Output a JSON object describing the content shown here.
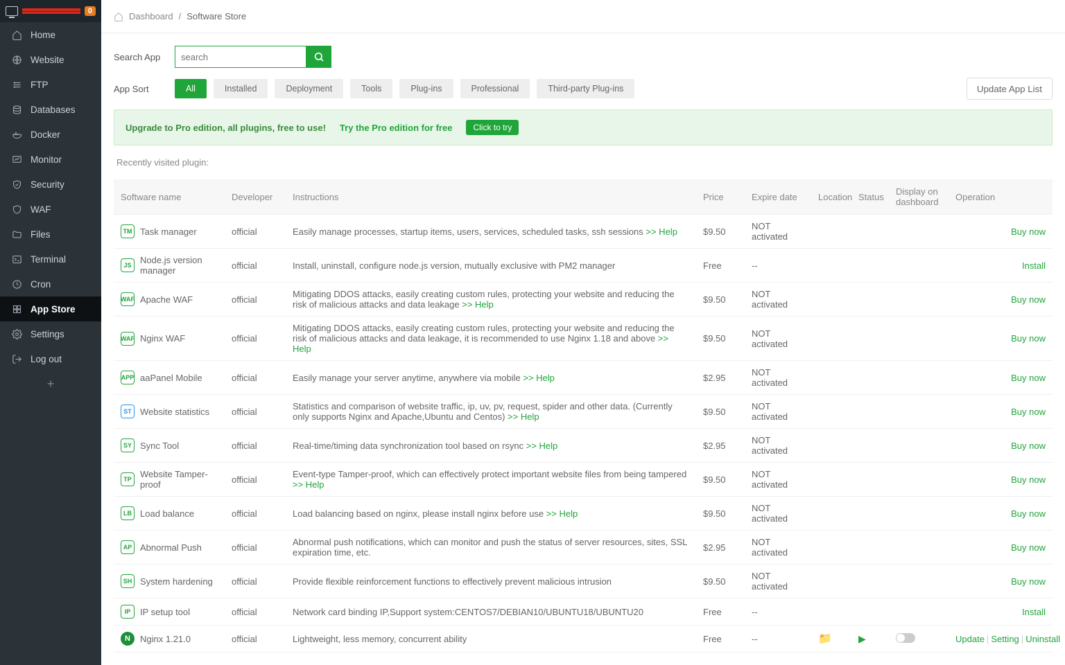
{
  "sidebar": {
    "badge": "0",
    "items": [
      {
        "icon": "home",
        "label": "Home"
      },
      {
        "icon": "globe",
        "label": "Website"
      },
      {
        "icon": "ftp",
        "label": "FTP"
      },
      {
        "icon": "database",
        "label": "Databases"
      },
      {
        "icon": "docker",
        "label": "Docker"
      },
      {
        "icon": "monitor",
        "label": "Monitor"
      },
      {
        "icon": "shield",
        "label": "Security"
      },
      {
        "icon": "waf",
        "label": "WAF"
      },
      {
        "icon": "folder",
        "label": "Files"
      },
      {
        "icon": "terminal",
        "label": "Terminal"
      },
      {
        "icon": "cron",
        "label": "Cron"
      },
      {
        "icon": "grid",
        "label": "App Store",
        "active": true
      },
      {
        "icon": "gear",
        "label": "Settings"
      },
      {
        "icon": "logout",
        "label": "Log out"
      }
    ]
  },
  "breadcrumb": {
    "dashboard": "Dashboard",
    "current": "Software Store"
  },
  "search": {
    "label": "Search App",
    "placeholder": "search"
  },
  "sort": {
    "label": "App Sort",
    "buttons": [
      "All",
      "Installed",
      "Deployment",
      "Tools",
      "Plug-ins",
      "Professional",
      "Third-party Plug-ins"
    ],
    "active": 0,
    "update": "Update App List"
  },
  "upgrade": {
    "bold": "Upgrade to Pro edition, all plugins, free to use!",
    "try": "Try the Pro edition for free",
    "click": "Click to try"
  },
  "recent": "Recently visited plugin:",
  "table": {
    "headers": {
      "name": "Software name",
      "dev": "Developer",
      "instr": "Instructions",
      "price": "Price",
      "expire": "Expire date",
      "location": "Location",
      "status": "Status",
      "display": "Display on dashboard",
      "op": "Operation"
    },
    "help_label": ">> Help",
    "ops": {
      "buy": "Buy now",
      "install": "Install",
      "update": "Update",
      "setting": "Setting",
      "uninstall": "Uninstall"
    },
    "rows": [
      {
        "icon": "TM",
        "color": "green",
        "name": "Task manager",
        "dev": "official",
        "instr": "Easily manage processes, startup items, users, services, scheduled tasks, ssh sessions ",
        "help": true,
        "price": "$9.50",
        "expire": "NOT activated",
        "op": "buy"
      },
      {
        "icon": "JS",
        "color": "green",
        "name": "Node.js version manager",
        "dev": "official",
        "instr": "Install, uninstall, configure node.js version, mutually exclusive with PM2 manager",
        "help": false,
        "price": "Free",
        "expire": "--",
        "op": "install"
      },
      {
        "icon": "WAF",
        "color": "green",
        "name": "Apache WAF",
        "dev": "official",
        "instr": "Mitigating DDOS attacks, easily creating custom rules, protecting your website and reducing the risk of malicious attacks and data leakage ",
        "help": true,
        "price": "$9.50",
        "expire": "NOT activated",
        "op": "buy"
      },
      {
        "icon": "WAF",
        "color": "green",
        "name": "Nginx WAF",
        "dev": "official",
        "instr": "Mitigating DDOS attacks, easily creating custom rules, protecting your website and reducing the risk of malicious attacks and data leakage, it is recommended to use Nginx 1.18 and above  ",
        "help": true,
        "price": "$9.50",
        "expire": "NOT activated",
        "op": "buy"
      },
      {
        "icon": "APP",
        "color": "green",
        "name": "aaPanel Mobile",
        "dev": "official",
        "instr": "Easily manage your server anytime, anywhere via mobile ",
        "help": true,
        "price": "$2.95",
        "expire": "NOT activated",
        "op": "buy"
      },
      {
        "icon": "ST",
        "color": "blue",
        "name": "Website statistics",
        "dev": "official",
        "instr": "Statistics and comparison of website traffic, ip, uv, pv, request, spider and other data. (Currently only supports Nginx and Apache,Ubuntu and Centos)  ",
        "help": true,
        "price": "$9.50",
        "expire": "NOT activated",
        "op": "buy"
      },
      {
        "icon": "SY",
        "color": "green",
        "name": "Sync Tool",
        "dev": "official",
        "instr": "Real-time/timing data synchronization tool based on rsync ",
        "help": true,
        "price": "$2.95",
        "expire": "NOT activated",
        "op": "buy"
      },
      {
        "icon": "TP",
        "color": "green",
        "name": "Website Tamper-proof",
        "dev": "official",
        "instr": "Event-type Tamper-proof, which can effectively protect important website files from being tampered ",
        "help": true,
        "price": "$9.50",
        "expire": "NOT activated",
        "op": "buy"
      },
      {
        "icon": "LB",
        "color": "green",
        "name": "Load balance",
        "dev": "official",
        "instr": "Load balancing based on nginx, please install nginx before use ",
        "help": true,
        "price": "$9.50",
        "expire": "NOT activated",
        "op": "buy"
      },
      {
        "icon": "AP",
        "color": "green",
        "name": "Abnormal Push",
        "dev": "official",
        "instr": "Abnormal push notifications, which can monitor and push the status of server resources, sites, SSL expiration time, etc.",
        "help": false,
        "price": "$2.95",
        "expire": "NOT activated",
        "op": "buy"
      },
      {
        "icon": "SH",
        "color": "green",
        "name": "System hardening",
        "dev": "official",
        "instr": "Provide flexible reinforcement functions to effectively prevent malicious intrusion",
        "help": false,
        "price": "$9.50",
        "expire": "NOT activated",
        "op": "buy"
      },
      {
        "icon": "IP",
        "color": "green",
        "name": "IP setup tool",
        "dev": "official",
        "instr": "Network card binding IP,Support system:CENTOS7/DEBIAN10/UBUNTU18/UBUNTU20",
        "help": false,
        "price": "Free",
        "expire": "--",
        "op": "install"
      },
      {
        "icon": "N",
        "color": "nginx",
        "name": "Nginx 1.21.0",
        "dev": "official",
        "instr": "Lightweight, less memory, concurrent ability",
        "help": false,
        "price": "Free",
        "expire": "--",
        "op": "triple",
        "location": true,
        "status": true,
        "display": true
      }
    ]
  }
}
